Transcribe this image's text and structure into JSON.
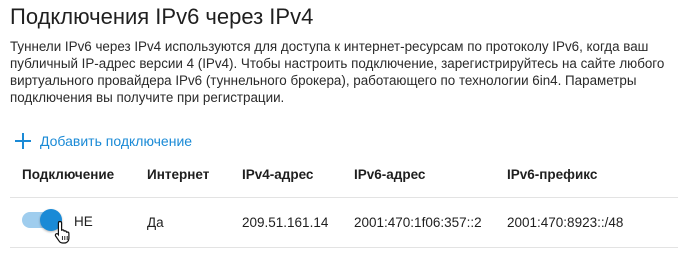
{
  "page": {
    "title": "Подключения IPv6 через IPv4",
    "description": "Туннели IPv6 через IPv4 используются для доступа к интернет-ресурсам по протоколу IPv6, когда ваш публичный IP-адрес версии 4 (IPv4). Чтобы настроить подключение, зарегистрируйтесь на сайте любого виртуального провайдера IPv6 (туннельного брокера), работающего по технологии 6in4. Параметры подключения вы получите при регистрации."
  },
  "actions": {
    "add_connection_label": "Добавить подключение"
  },
  "table": {
    "headers": [
      "Подключение",
      "Интернет",
      "IPv4-адрес",
      "IPv6-адрес",
      "IPv6-префикс"
    ],
    "rows": [
      {
        "enabled": true,
        "status": "НЕ",
        "internet": "Да",
        "ipv4": "209.51.161.14",
        "ipv6": "2001:470:1f06:357::2",
        "prefix": "2001:470:8923::/48"
      }
    ]
  },
  "colors": {
    "accent": "#1a8ad6",
    "toggle_track": "#9fcdee"
  },
  "icons": {
    "add": "plus-icon",
    "cursor": "hand-pointer-icon"
  }
}
